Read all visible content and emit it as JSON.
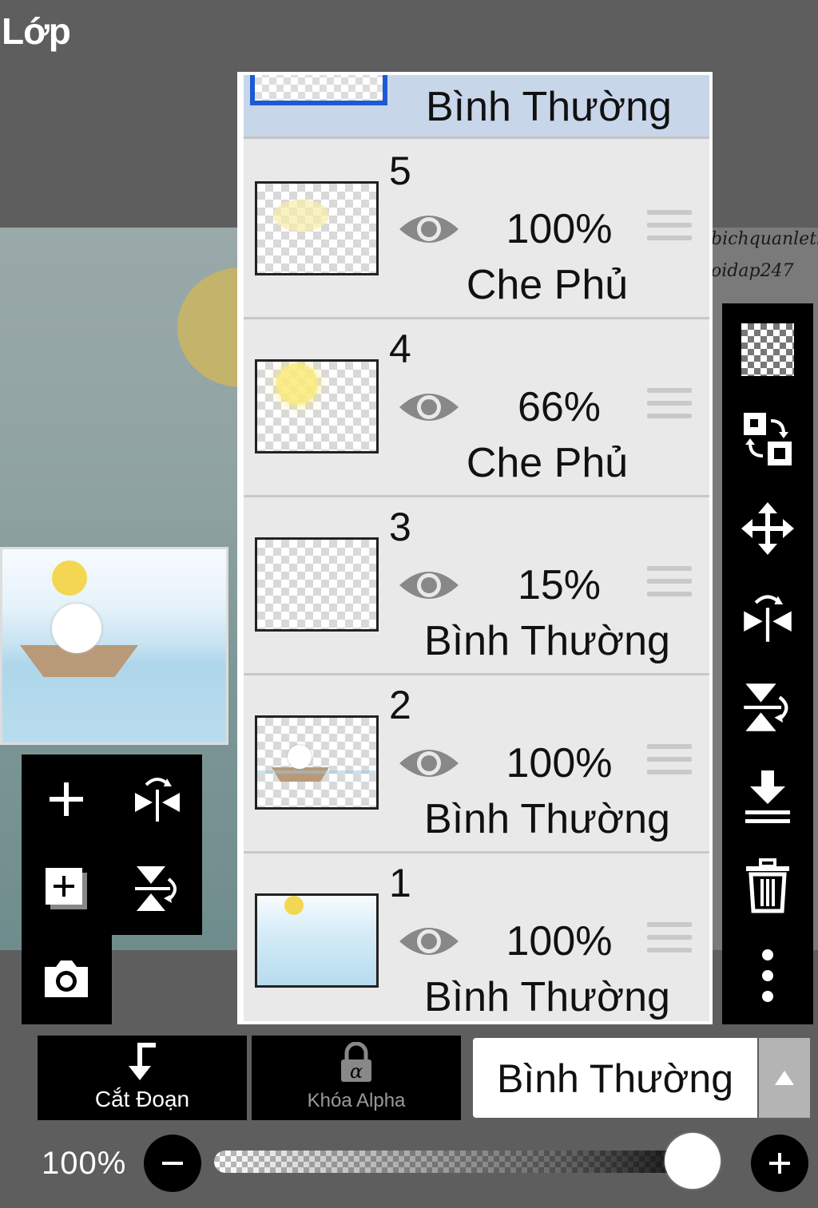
{
  "header": {
    "title": "Lớp"
  },
  "watermark": {
    "line1": "bichquanleth",
    "line2": "oidap247"
  },
  "layers_panel": {
    "selected_layer": {
      "blend_mode": "Bình Thường"
    },
    "layers": [
      {
        "number": "5",
        "opacity": "100%",
        "blend_mode": "Che Phủ"
      },
      {
        "number": "4",
        "opacity": "66%",
        "blend_mode": "Che Phủ"
      },
      {
        "number": "3",
        "opacity": "15%",
        "blend_mode": "Bình Thường"
      },
      {
        "number": "2",
        "opacity": "100%",
        "blend_mode": "Bình Thường"
      },
      {
        "number": "1",
        "opacity": "100%",
        "blend_mode": "Bình Thường"
      }
    ]
  },
  "bottom_bar": {
    "clipping_label": "Cắt Đoạn",
    "alpha_lock_label": "Khóa Alpha",
    "blend_mode_value": "Bình Thường"
  },
  "opacity_slider": {
    "value_label": "100%",
    "value": 1.0
  },
  "left_tools": [
    "add-layer-icon",
    "flip-horizontal-icon",
    "add-folder-icon",
    "flip-vertical-icon",
    "camera-icon"
  ],
  "right_tools": [
    "transparency-icon",
    "swap-layers-icon",
    "move-icon",
    "flip-horizontal-icon",
    "flip-vertical-icon",
    "merge-down-icon",
    "trash-icon",
    "more-vertical-icon"
  ],
  "colors": {
    "selected_frame": "#1c5ad4",
    "selected_row": "#c8d6ea",
    "panel_bg": "#e9e9e9",
    "toolbar": "#000000"
  }
}
